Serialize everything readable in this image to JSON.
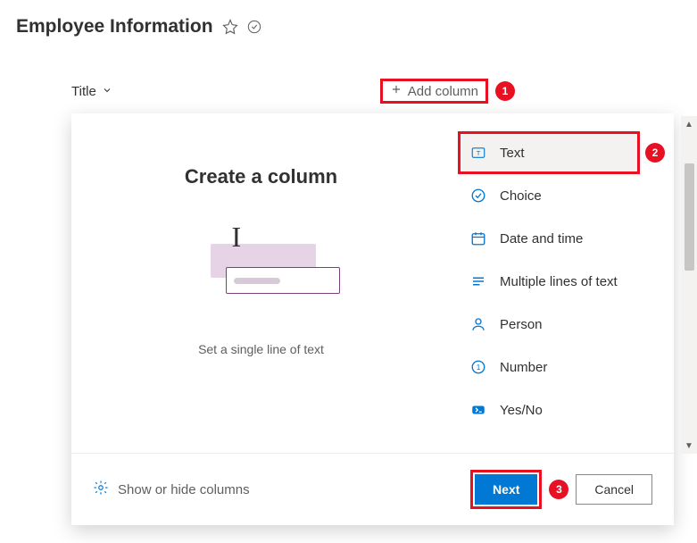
{
  "header": {
    "title": "Employee Information"
  },
  "columns": {
    "title_label": "Title",
    "add_label": "Add column"
  },
  "panel": {
    "heading": "Create a column",
    "subheading": "Set a single line of text",
    "types": {
      "text": "Text",
      "choice": "Choice",
      "datetime": "Date and time",
      "multiline": "Multiple lines of text",
      "person": "Person",
      "number": "Number",
      "yesno": "Yes/No"
    },
    "footer_link": "Show or hide columns",
    "next_label": "Next",
    "cancel_label": "Cancel"
  },
  "annotations": {
    "a1": "1",
    "a2": "2",
    "a3": "3"
  }
}
